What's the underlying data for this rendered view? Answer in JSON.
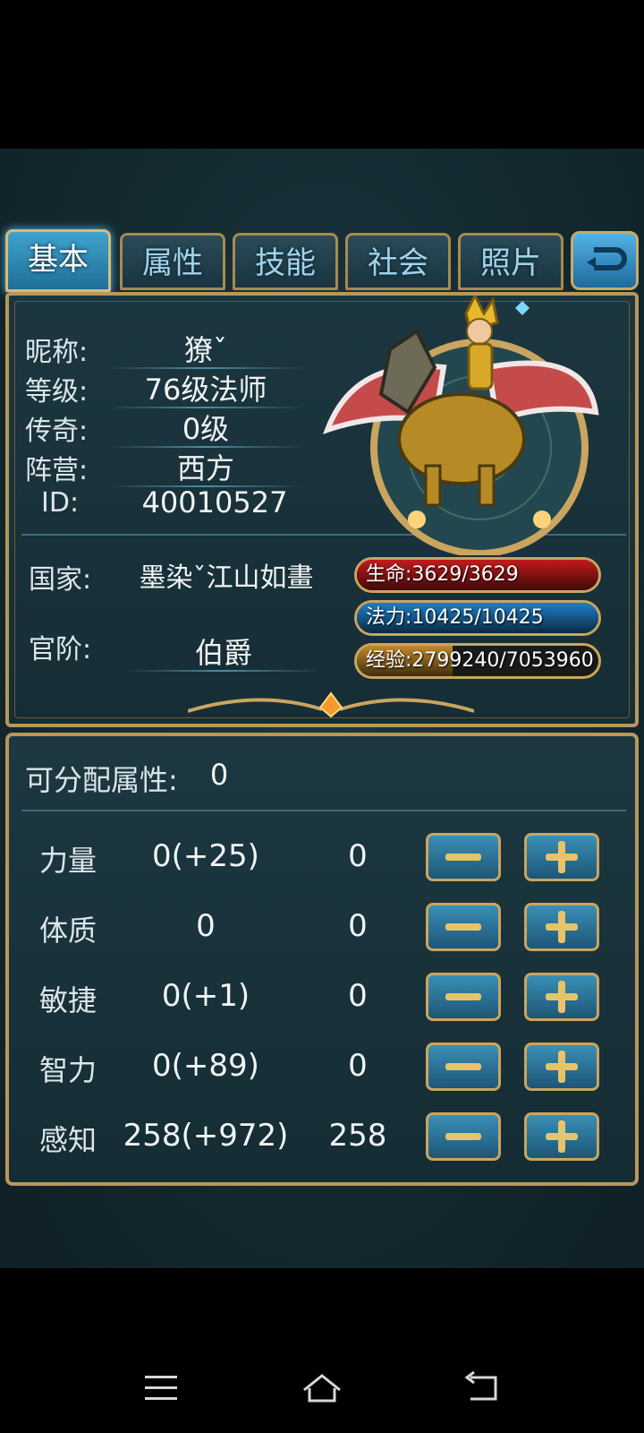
{
  "tabs": [
    {
      "label": "基本",
      "active": true
    },
    {
      "label": "属性",
      "active": false
    },
    {
      "label": "技能",
      "active": false
    },
    {
      "label": "社会",
      "active": false
    },
    {
      "label": "照片",
      "active": false
    }
  ],
  "profile": {
    "nickname_label": "昵称:",
    "nickname": "獠ˇ",
    "level_label": "等级:",
    "level": "76级法师",
    "legend_label": "传奇:",
    "legend": "0级",
    "camp_label": "阵营:",
    "camp": "西方",
    "id_label": "ID:",
    "id": "40010527",
    "country_label": "国家:",
    "country": "墨染ˇ江山如畫",
    "rank_label": "官阶:",
    "rank": "伯爵"
  },
  "stats": {
    "hp": {
      "text": "生命:3629/3629",
      "fraction": 1.0,
      "color": "#c11b1b"
    },
    "mp": {
      "text": "法力:10425/10425",
      "fraction": 1.0,
      "color": "#1e7fc9"
    },
    "exp": {
      "text": "经验:2799240/7053960",
      "fraction": 0.397,
      "color": "#c08a2a"
    }
  },
  "attributes": {
    "points_label": "可分配属性:",
    "points": "0",
    "rows": [
      {
        "name": "力量",
        "base": "0(+25)",
        "added": "0"
      },
      {
        "name": "体质",
        "base": "0",
        "added": "0"
      },
      {
        "name": "敏捷",
        "base": "0(+1)",
        "added": "0"
      },
      {
        "name": "智力",
        "base": "0(+89)",
        "added": "0"
      },
      {
        "name": "感知",
        "base": "258(+972)",
        "added": "258"
      }
    ]
  },
  "colors": {
    "gold": "#b8975a",
    "accent": "#3fa3cd"
  }
}
